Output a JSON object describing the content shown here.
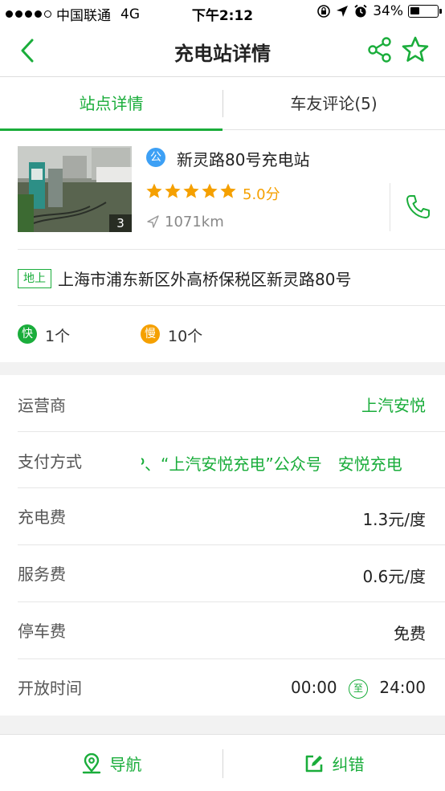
{
  "status_bar": {
    "carrier": "中国联通",
    "network": "4G",
    "time": "下午2:12",
    "battery": "34%",
    "battery_level": 0.34
  },
  "nav": {
    "title": "充电站详情",
    "back_icon": "chevron-left-icon",
    "share_icon": "share-icon",
    "favorite_icon": "star-outline-icon"
  },
  "tabs": [
    {
      "label": "站点详情",
      "active": true
    },
    {
      "label": "车友评论(5)",
      "active": false
    }
  ],
  "station": {
    "photo_count": "3",
    "public_badge": "公",
    "name": "新灵路80号充电站",
    "rating": 5,
    "score": "5.0分",
    "distance": "1071km",
    "phone_icon": "phone-icon"
  },
  "address": {
    "tag": "地上",
    "text": "上海市浦东新区外高桥保税区新灵路80号"
  },
  "chargers": {
    "fast_badge": "快",
    "fast_count": "1个",
    "slow_badge": "慢",
    "slow_count": "10个"
  },
  "details": {
    "operator_label": "运营商",
    "operator_value": "上汽安悦",
    "payment_label": "支付方式",
    "payment_value": "P、“上汽安悦充电”公众号　安悦充电",
    "charge_fee_label": "充电费",
    "charge_fee_value": "1.3元/度",
    "service_fee_label": "服务费",
    "service_fee_value": "0.6元/度",
    "parking_fee_label": "停车费",
    "parking_fee_value": "免费",
    "hours_label": "开放时间",
    "hours_start": "00:00",
    "hours_to": "至",
    "hours_end": "24:00"
  },
  "bottom": {
    "navigate_label": "导航",
    "correct_label": "纠错"
  },
  "colors": {
    "accent": "#1aad3b",
    "rating": "#f5a000",
    "public_badge": "#3da0f5"
  }
}
